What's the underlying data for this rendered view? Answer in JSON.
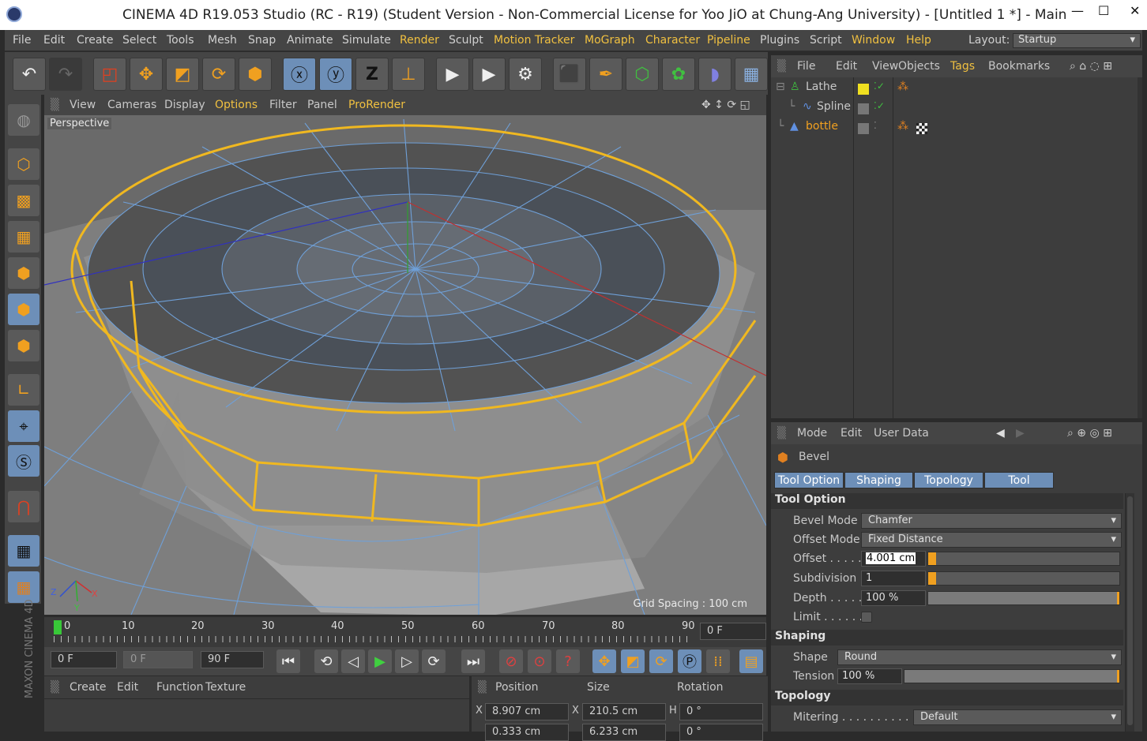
{
  "window": {
    "title": "CINEMA 4D R19.053 Studio (RC - R19) (Student Version - Non-Commercial License for Yoo JiO at Chung-Ang University) - [Untitled 1 *] - Main",
    "minimize": "—",
    "maximize": "☐",
    "close": "✕"
  },
  "menu": [
    "File",
    "Edit",
    "Create",
    "Select",
    "Tools",
    "Mesh",
    "Snap",
    "Animate",
    "Simulate",
    "Render",
    "Sculpt",
    "Motion Tracker",
    "MoGraph",
    "Character",
    "Pipeline",
    "Plugins",
    "Script",
    "Window",
    "Help"
  ],
  "layout": {
    "label": "Layout:",
    "value": "Startup"
  },
  "viewport": {
    "menu": [
      "View",
      "Cameras",
      "Display",
      "Options",
      "Filter",
      "Panel",
      "ProRender"
    ],
    "label": "Perspective",
    "grid": "Grid Spacing : 100 cm",
    "axis_x": "X",
    "axis_y": "Y",
    "axis_z": "Z"
  },
  "timeline": {
    "ticks": [
      "0",
      "10",
      "20",
      "30",
      "40",
      "50",
      "60",
      "70",
      "80",
      "90"
    ],
    "end_field": "0 F"
  },
  "transport": {
    "current": "0 F",
    "min": "0 F",
    "max": "90 F"
  },
  "material_menu": [
    "Create",
    "Edit",
    "Function",
    "Texture"
  ],
  "coords": {
    "headers": [
      "Position",
      "Size",
      "Rotation"
    ],
    "row1": {
      "x_label": "X",
      "pos": "8.907 cm",
      "size_label": "X",
      "size": "210.5 cm",
      "rot_label": "H",
      "rot": "0 °"
    },
    "row2": {
      "pos": "0.333 cm",
      "size": "6.233 cm",
      "rot": "0 °"
    }
  },
  "objects": {
    "menu": [
      "File",
      "Edit",
      "View",
      "Objects",
      "Tags",
      "Bookmarks"
    ],
    "items": [
      {
        "name": "Lathe"
      },
      {
        "name": "Spline"
      },
      {
        "name": "bottle"
      }
    ]
  },
  "attributes": {
    "menu": [
      "Mode",
      "Edit",
      "User Data"
    ],
    "tool": "Bevel",
    "tabs": [
      "Tool Option",
      "Shaping",
      "Topology",
      "Tool"
    ],
    "sections": {
      "tool_option": "Tool Option",
      "shaping": "Shaping",
      "topology": "Topology"
    },
    "bevel_mode": {
      "label": "Bevel Mode",
      "value": "Chamfer"
    },
    "offset_mode": {
      "label": "Offset Mode",
      "value": "Fixed Distance"
    },
    "offset": {
      "label": "Offset . . . . .",
      "value": "4.001 cm"
    },
    "subdivision": {
      "label": "Subdivision",
      "value": "1"
    },
    "depth": {
      "label": "Depth . . . . .",
      "value": "100 %"
    },
    "limit": {
      "label": "Limit . . . . . ."
    },
    "shape": {
      "label": "Shape",
      "value": "Round"
    },
    "tension": {
      "label": "Tension",
      "value": "100 %"
    },
    "mitering": {
      "label": "Mitering . . . . . . . . . . . .",
      "value": "Default"
    }
  },
  "colors": {
    "accent": "#f0c040",
    "select": "#f0b820",
    "panel": "#3d3d3d",
    "tab": "#6d8fb8"
  }
}
